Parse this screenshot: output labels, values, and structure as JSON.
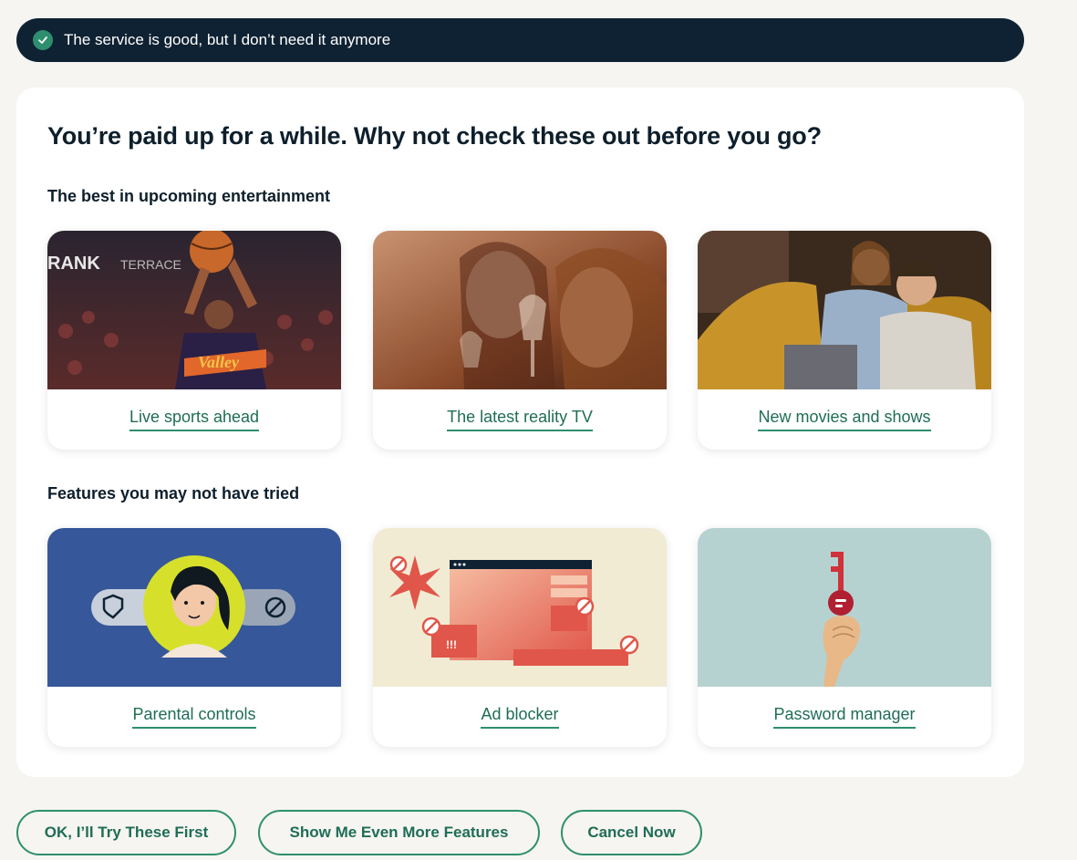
{
  "reason_bar": {
    "icon": "check-circle-icon",
    "text": "The service is good, but I don’t need it anymore"
  },
  "panel": {
    "heading": "You’re paid up for a while. Why not check these out before you go?",
    "entertainment": {
      "title": "The best in upcoming entertainment",
      "cards": [
        {
          "label": "Live sports ahead",
          "image": "basketball-player-image"
        },
        {
          "label": "The latest reality TV",
          "image": "women-with-wine-image"
        },
        {
          "label": "New movies and shows",
          "image": "couple-on-couch-image"
        }
      ]
    },
    "features": {
      "title": "Features you may not have tried",
      "cards": [
        {
          "label": "Parental controls",
          "image": "parental-controls-illustration"
        },
        {
          "label": "Ad blocker",
          "image": "ad-blocker-illustration"
        },
        {
          "label": "Password manager",
          "image": "password-key-illustration"
        }
      ]
    }
  },
  "actions": {
    "try_first": "OK, I’ll Try These First",
    "more_features": "Show Me Even More Features",
    "cancel": "Cancel Now"
  },
  "colors": {
    "dark_navy": "#0f2233",
    "accent_green": "#2e8f6e",
    "link_green": "#1f6d56",
    "page_bg": "#f6f5f1"
  }
}
